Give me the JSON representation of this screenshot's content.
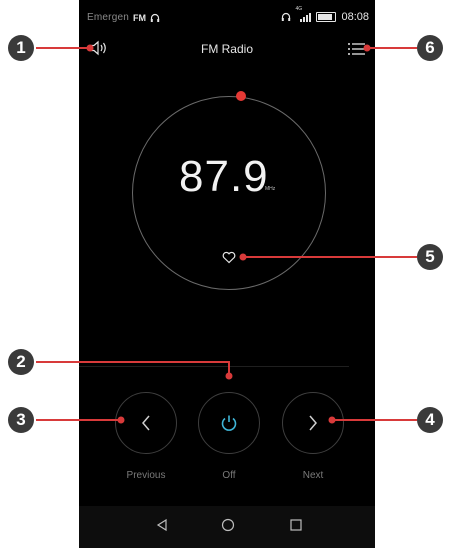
{
  "status_bar": {
    "carrier": "Emergen",
    "fm_badge": "FM",
    "network": "4G",
    "time": "08:08"
  },
  "app": {
    "title": "FM Radio"
  },
  "tuner": {
    "frequency": "87.9",
    "unit": "MHz"
  },
  "controls": {
    "previous_label": "Previous",
    "power_label": "Off",
    "next_label": "Next"
  },
  "callouts": [
    "1",
    "2",
    "3",
    "4",
    "5",
    "6"
  ],
  "colors": {
    "accent_red": "#e53935",
    "power_cyan": "#3fb6d8",
    "callout_line": "#d83a3a",
    "background": "#000000"
  },
  "icons": {
    "speaker": "speaker-icon",
    "menu": "menu-icon",
    "favorite": "heart-icon",
    "previous": "chevron-left-icon",
    "power": "power-icon",
    "next": "chevron-right-icon",
    "back": "back-triangle-icon",
    "home": "home-circle-icon",
    "recents": "recents-square-icon"
  }
}
